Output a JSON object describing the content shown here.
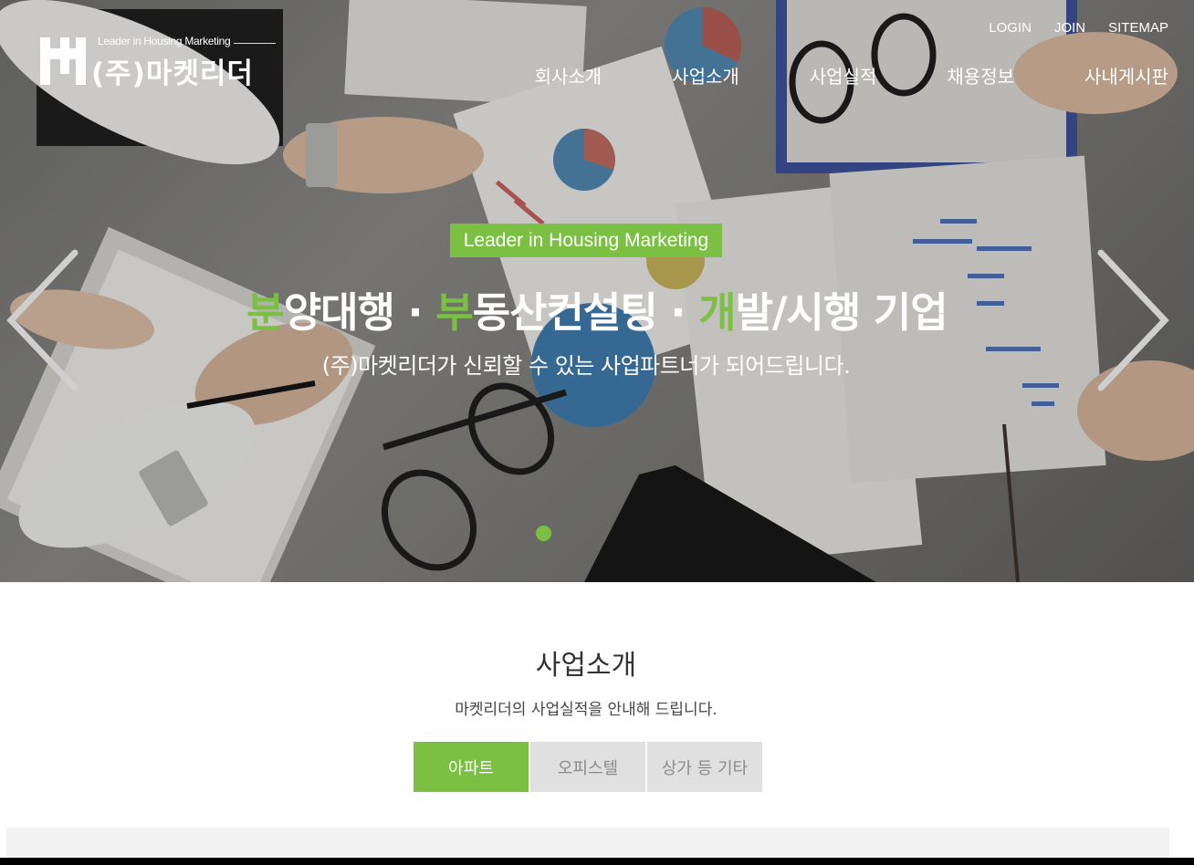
{
  "header": {
    "logo": {
      "tagline": "Leader in Housing Marketing",
      "name": "(주)마켓리더"
    },
    "util_links": [
      "LOGIN",
      "JOIN",
      "SITEMAP"
    ],
    "nav": [
      "회사소개",
      "사업소개",
      "사업실적",
      "채용정보",
      "사내게시판"
    ]
  },
  "hero": {
    "badge": "Leader in Housing Marketing",
    "headline": [
      {
        "initial": "분",
        "rest": "양대행"
      },
      {
        "initial": "부",
        "rest": "동산컨설팅"
      },
      {
        "initial": "개",
        "rest": "발/시행 기업"
      }
    ],
    "separator": " · ",
    "subtitle": "(주)마켓리더가 신뢰할 수 있는 사업파트너가 되어드립니다.",
    "prev_icon": "chevron-left-icon",
    "next_icon": "chevron-right-icon",
    "slide_count": 1,
    "active_slide": 1
  },
  "business": {
    "title": "사업소개",
    "description": "마켓리더의 사업실적을 안내해 드립니다.",
    "tabs": [
      {
        "label": "아파트",
        "active": true
      },
      {
        "label": "오피스텔",
        "active": false
      },
      {
        "label": "상가 등 기타",
        "active": false
      }
    ]
  },
  "colors": {
    "accent": "#7bc043",
    "tab_inactive_bg": "#e0e0e0",
    "tab_inactive_text": "#8a8a8a",
    "gallery_bg": "#f2f2f2"
  }
}
